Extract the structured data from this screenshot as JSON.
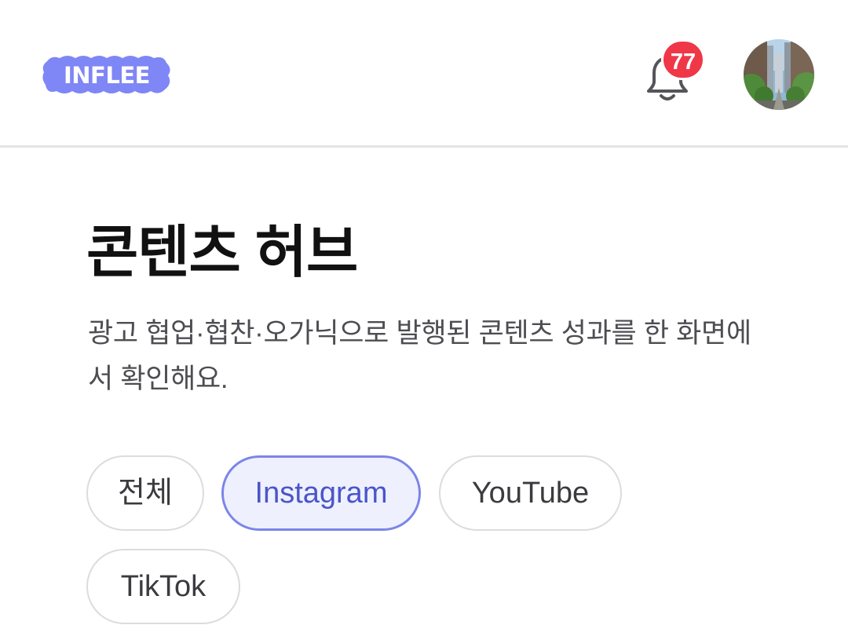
{
  "header": {
    "logo_text": "INFLEE",
    "notification_count": "77",
    "colors": {
      "logo_bg": "#7f86f5",
      "badge_bg": "#ef3748",
      "divider": "#e4e4e6"
    },
    "icons": {
      "bell": "bell-icon",
      "avatar": "profile-avatar-photo"
    }
  },
  "main": {
    "title": "콘텐츠 허브",
    "description": "광고 협업·협찬·오가닉으로 발행된 콘텐츠 성과를 한 화면에서 확인해요.",
    "filters": [
      {
        "label": "전체",
        "active": false
      },
      {
        "label": "Instagram",
        "active": true
      },
      {
        "label": "YouTube",
        "active": false
      },
      {
        "label": "TikTok",
        "active": false
      }
    ],
    "colors": {
      "active_chip_bg": "#eef0fd",
      "active_chip_border": "#7b85e8",
      "active_chip_text": "#4a55c9"
    }
  }
}
